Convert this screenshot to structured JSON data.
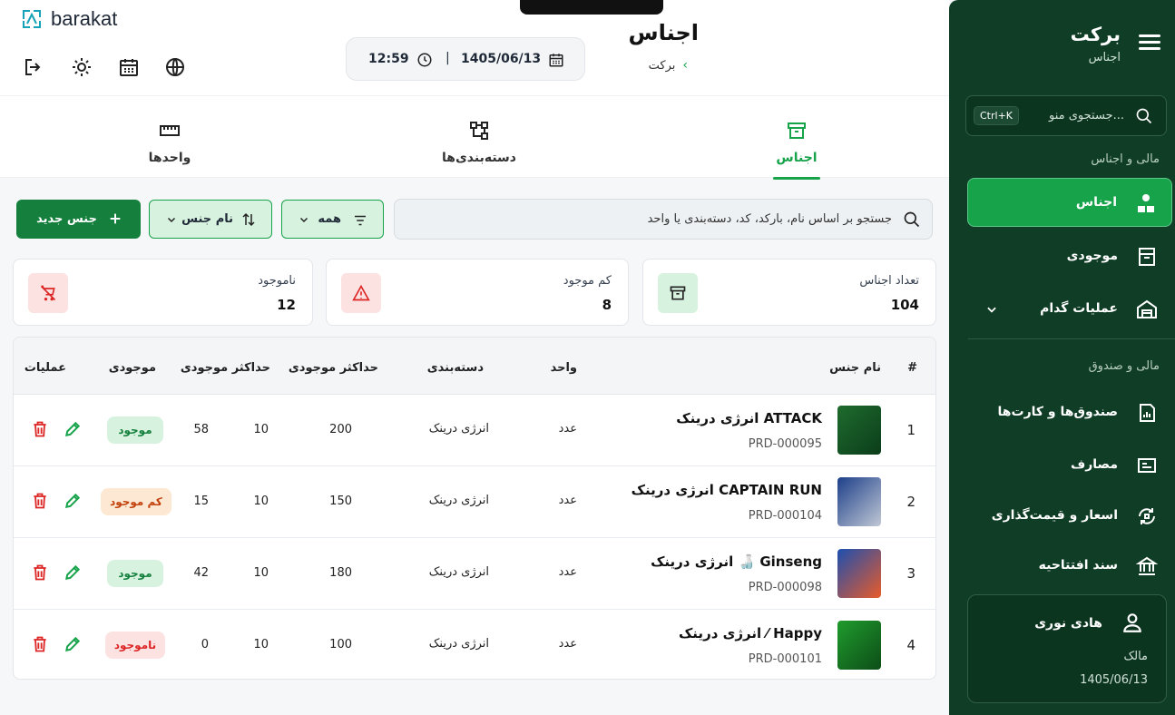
{
  "app": {
    "logo_text": "barakat",
    "title": "برکت",
    "subtitle": "اجناس"
  },
  "header": {
    "time": "12:59",
    "separator": "|",
    "date": "1405/06/13",
    "page_title": "اجناس",
    "breadcrumb": "برکت"
  },
  "sidebar": {
    "search_placeholder": "جستجوی منو...",
    "search_shortcut": "Ctrl+K",
    "section1": "مالی و اجناس",
    "section2": "مالی و صندوق",
    "items": [
      {
        "label": "اجناس",
        "icon": "products-icon"
      },
      {
        "label": "موجودی",
        "icon": "inventory-icon"
      },
      {
        "label": "عملیات گدام",
        "icon": "warehouse-icon"
      },
      {
        "label": "صندوق‌ها و کارت‌ها",
        "icon": "cashbox-icon"
      },
      {
        "label": "مصارف",
        "icon": "expenses-icon"
      },
      {
        "label": "اسعار و قیمت‌گذاری",
        "icon": "currency-icon"
      },
      {
        "label": "سند افتتاحیه",
        "icon": "bank-icon"
      }
    ],
    "user": {
      "name": "هادی نوری",
      "role": "مالک",
      "date": "1405/06/13"
    }
  },
  "tabs": [
    {
      "label": "اجناس",
      "active": true
    },
    {
      "label": "دسته‌بندی‌ها",
      "active": false
    },
    {
      "label": "واحدها",
      "active": false
    }
  ],
  "toolbar": {
    "search_placeholder": "جستجو بر اساس نام، بارکد، کد، دسته‌بندی یا واحد",
    "filter_all": "همه",
    "sort_label": "نام جنس",
    "new_button": "جنس جدید"
  },
  "stats": [
    {
      "label": "تعداد اجناس",
      "value": "104",
      "color": "#16a34a"
    },
    {
      "label": "کم موجود",
      "value": "8",
      "color": "#dc2626"
    },
    {
      "label": "ناموجود",
      "value": "12",
      "color": "#dc2626"
    }
  ],
  "table": {
    "headers": {
      "num": "#",
      "name": "نام جنس",
      "unit": "واحد",
      "category": "دسته‌بندی",
      "max1": "حداکثر موجودی",
      "max2": "حداکثر موجودی",
      "stock": "موجودی",
      "actions": "عملیات"
    },
    "rows": [
      {
        "num": "1",
        "name": "ATTACK انرژی درینک",
        "code": "PRD-000095",
        "unit": "عدد",
        "category": "انرژی درینک",
        "max": "200",
        "min": "10",
        "qty": "58",
        "status": "موجود",
        "status_type": "ok"
      },
      {
        "num": "2",
        "name": "CAPTAIN RUN انرژی درینک",
        "code": "PRD-000104",
        "unit": "عدد",
        "category": "انرژی درینک",
        "max": "150",
        "min": "10",
        "qty": "15",
        "status": "کم موجود",
        "status_type": "low"
      },
      {
        "num": "3",
        "name": "Ginseng 🍶 انرژی درینک",
        "code": "PRD-000098",
        "unit": "عدد",
        "category": "انرژی درینک",
        "max": "180",
        "min": "10",
        "qty": "42",
        "status": "موجود",
        "status_type": "ok"
      },
      {
        "num": "4",
        "name": "Happy ⁄ انرژی درینک",
        "code": "PRD-000101",
        "unit": "عدد",
        "category": "انرژی درینک",
        "max": "100",
        "min": "10",
        "qty": "0",
        "status": "ناموجود",
        "status_type": "out"
      }
    ]
  },
  "colors": {
    "primary": "#16a34a",
    "sidebar": "#0f3d25",
    "danger": "#dc2626",
    "warning": "#c2410c"
  }
}
